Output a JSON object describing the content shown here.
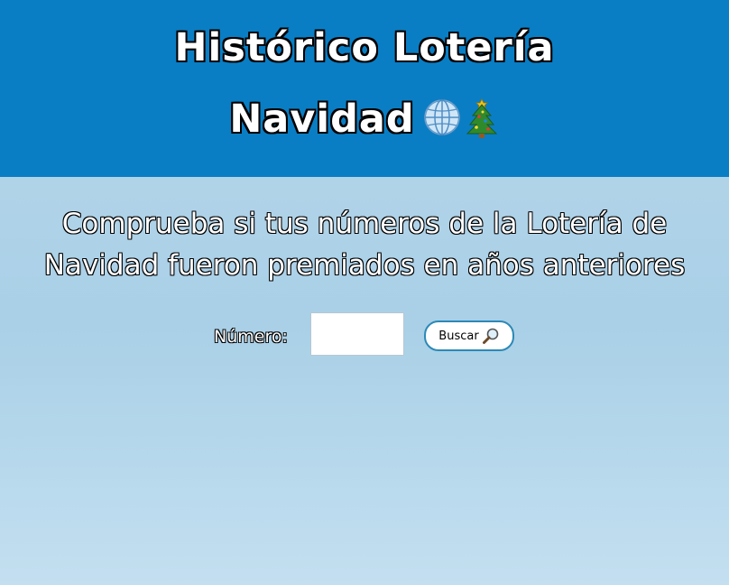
{
  "header": {
    "title_line1": "Histórico Lotería",
    "title_line2": "Navidad",
    "icons": [
      "globe-icon",
      "christmas-tree-icon"
    ],
    "background_color": "#0a7ec4"
  },
  "main": {
    "subtitle_line1": "Comprueba si tus números de la Lotería de",
    "subtitle_line2": "Navidad fueron premiados en años anteriores",
    "number_label": "Número:",
    "number_input_value": "",
    "search_button_label": "Buscar",
    "search_button_icon": "magnifier-icon",
    "button_border_color": "#2c89b7"
  }
}
